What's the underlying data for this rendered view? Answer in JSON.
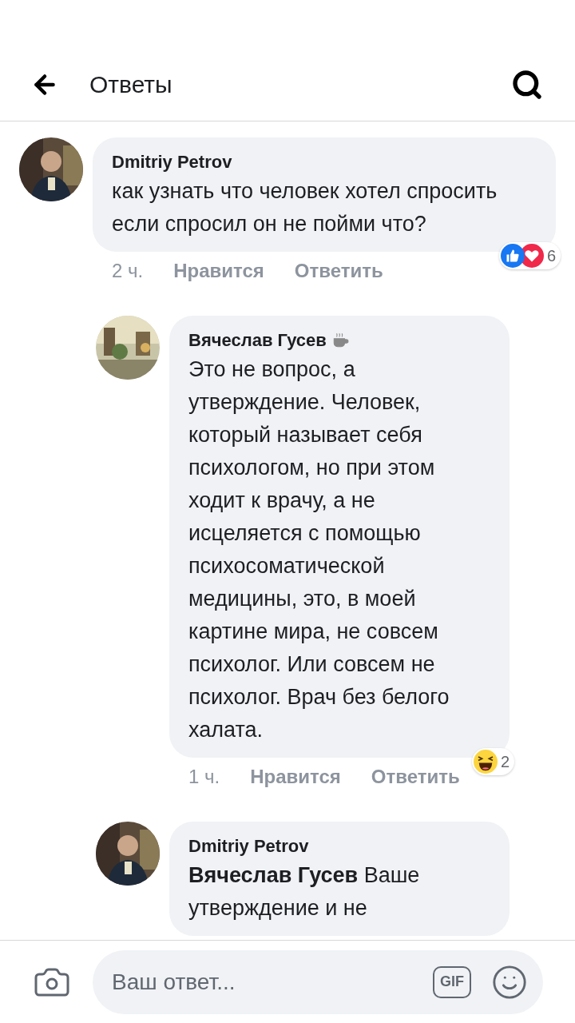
{
  "header": {
    "title": "Ответы"
  },
  "comments": [
    {
      "author": "Dmitriy Petrov",
      "author_badge": false,
      "text": "как узнать что человек хотел спросить если спросил он не пойми что?",
      "time": "2 ч.",
      "like": "Нравится",
      "reply": "Ответить",
      "reactions": [
        {
          "kind": "like"
        },
        {
          "kind": "love"
        }
      ],
      "reaction_count": "6",
      "nested": false
    },
    {
      "author": "Вячеслав Гусев",
      "author_badge": true,
      "text": "Это не вопрос, а утверждение. Человек, который называет себя психологом, но при этом ходит к врачу, а не исцеляется с помощью психосоматической медицины, это, в моей картине мира, не совсем психолог. Или совсем не психолог. Врач без белого халата.",
      "time": "1 ч.",
      "like": "Нравится",
      "reply": "Ответить",
      "reactions": [
        {
          "kind": "haha"
        }
      ],
      "reaction_count": "2",
      "nested": true
    },
    {
      "author": "Dmitriy Petrov",
      "author_badge": false,
      "text": "**Вячеслав Гусев** Ваше утверждение и не",
      "nested": true
    }
  ],
  "composer": {
    "placeholder": "Ваш ответ...",
    "gif": "GIF"
  }
}
